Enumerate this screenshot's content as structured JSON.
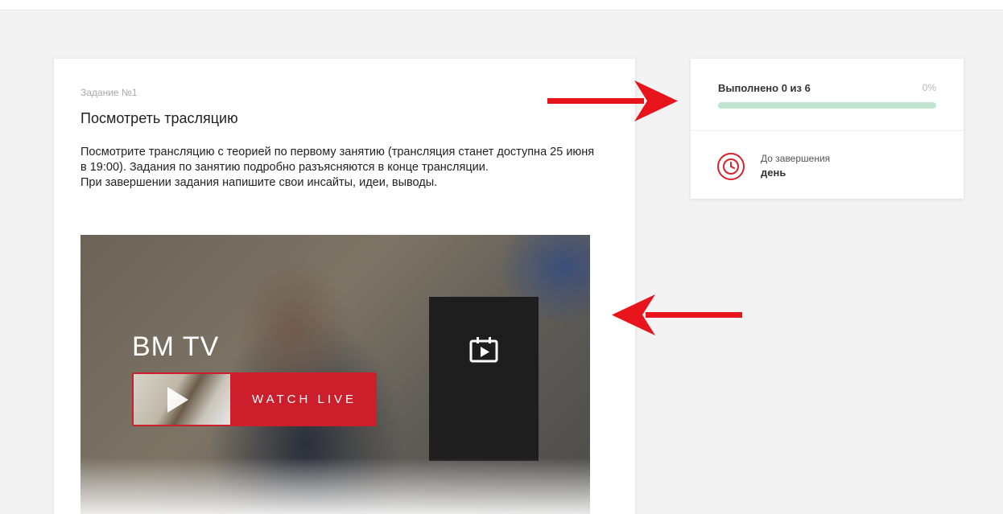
{
  "task": {
    "number_label": "Задание №1",
    "title": "Посмотреть трасляцию",
    "description_lines": [
      "Посмотрите трансляцию с теорией по первому занятию (трансляция станет доступна 25 июня в 19:00). Задания по занятию подробно разъясняются в конце трансляции.",
      "При завершении задания напишите свои инсайты, идеи, выводы."
    ]
  },
  "video": {
    "brand": "BM TV",
    "watch_label": "WATCH LIVE",
    "icons": {
      "play": "play-icon",
      "calendar": "calendar-play-icon"
    }
  },
  "progress": {
    "label": "Выполнено 0 из 6",
    "percent_label": "0%",
    "percent": 0
  },
  "deadline": {
    "label": "До завершения",
    "value": "день",
    "icon": "clock-icon"
  },
  "colors": {
    "accent_red": "#cc1f2b",
    "progress_track": "#bfe5cf",
    "annotation_arrow": "#e8141b"
  }
}
